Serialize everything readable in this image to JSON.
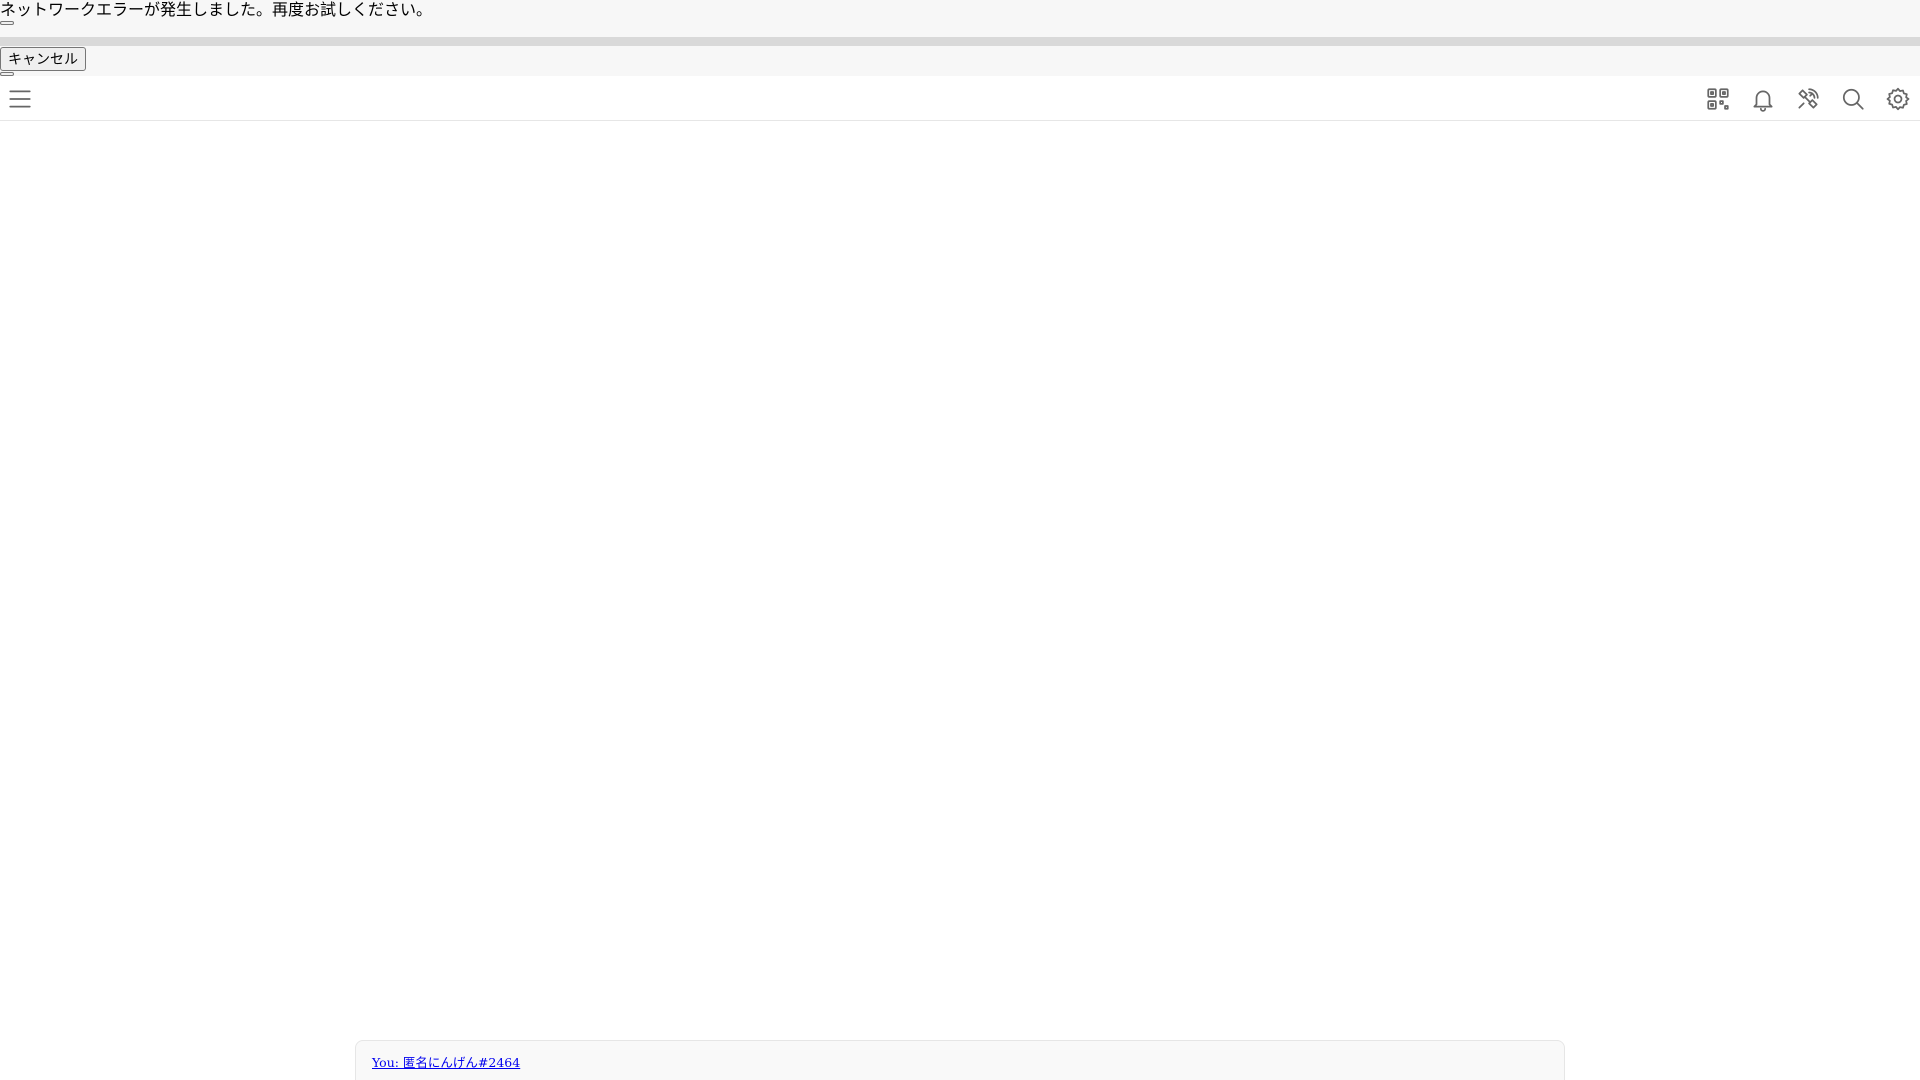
{
  "error": {
    "message": "ネットワークエラーが発生しました。再度お試しください。",
    "cancel_label": "キャンセル"
  },
  "toolbar": {
    "icons": [
      "menu-icon",
      "qr-code-icon",
      "bell-icon",
      "satellite-icon",
      "search-icon",
      "gear-icon"
    ]
  },
  "footer": {
    "user_link": "You: 匿名にんげん#2464"
  },
  "colors": {
    "icon": "#666666",
    "link": "#0000ee",
    "error_bg": "#f7f7f7",
    "panel_bg": "#f9f9f9"
  }
}
